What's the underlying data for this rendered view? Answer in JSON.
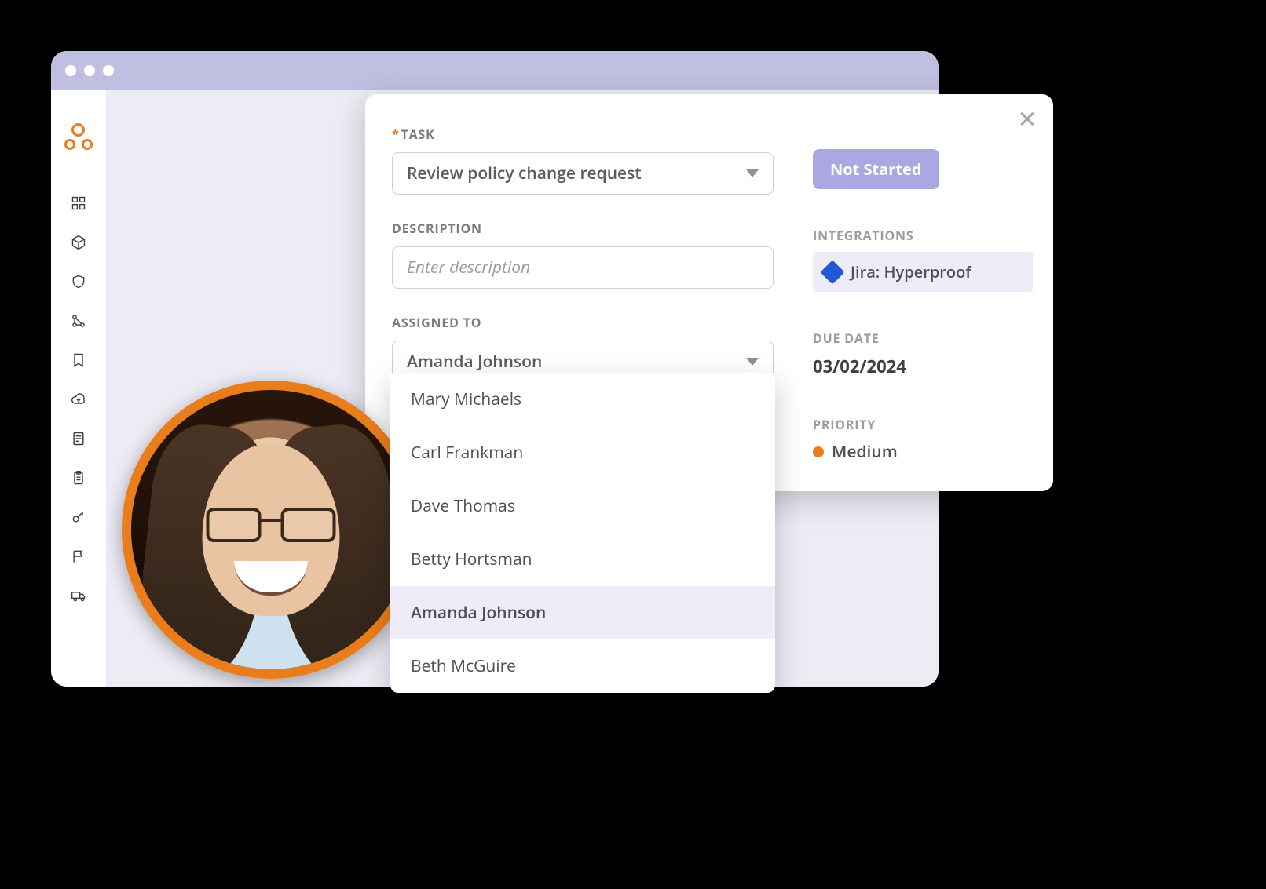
{
  "task": {
    "label": "TASK",
    "required_mark": "*",
    "value": "Review policy change request"
  },
  "description": {
    "label": "DESCRIPTION",
    "placeholder": "Enter description"
  },
  "assigned_to": {
    "label": "ASSIGNED TO",
    "value": "Amanda Johnson",
    "options": [
      "Mary Michaels",
      "Carl Frankman",
      "Dave Thomas",
      "Betty  Hortsman",
      "Amanda Johnson",
      "Beth McGuire"
    ],
    "selected_index": 4
  },
  "status": {
    "value": "Not Started"
  },
  "integrations": {
    "label": "INTEGRATIONS",
    "items": [
      "Jira: Hyperproof"
    ]
  },
  "due_date": {
    "label": "DUE DATE",
    "value": "03/02/2024"
  },
  "priority": {
    "label": "PRIORITY",
    "value": "Medium",
    "color": "#e97d1c"
  },
  "colors": {
    "accent_orange": "#e97d1c",
    "accent_lavender": "#aba7e0",
    "panel_lavender": "#edecf8",
    "titlebar": "#c1bfe0"
  },
  "sidebar_icons": [
    "dashboard-icon",
    "package-icon",
    "shield-icon",
    "workflow-icon",
    "bookmark-icon",
    "cloud-upload-icon",
    "document-icon",
    "clipboard-icon",
    "key-icon",
    "flag-icon",
    "truck-icon"
  ]
}
